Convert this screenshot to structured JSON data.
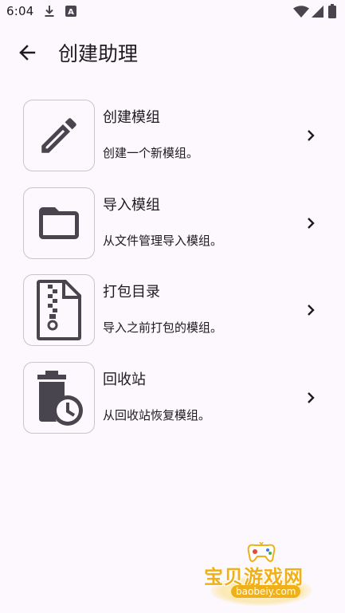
{
  "status_bar": {
    "time": "6:04",
    "icons": [
      "download-icon",
      "app-notification-a-icon",
      "wifi-icon",
      "signal-icon",
      "battery-icon"
    ],
    "notification_letter": "A"
  },
  "app_bar": {
    "back_icon": "arrow-left-icon",
    "title": "创建助理"
  },
  "menu_items": [
    {
      "icon": "pencil-icon",
      "title": "创建模组",
      "subtitle": "创建一个新模组。",
      "trailing_icon": "chevron-right-icon"
    },
    {
      "icon": "folder-icon",
      "title": "导入模组",
      "subtitle": "从文件管理导入模组。",
      "trailing_icon": "chevron-right-icon"
    },
    {
      "icon": "zip-file-icon",
      "title": "打包目录",
      "subtitle": "导入之前打包的模组。",
      "trailing_icon": "chevron-right-icon"
    },
    {
      "icon": "trash-clock-icon",
      "title": "回收站",
      "subtitle": "从回收站恢复模组。",
      "trailing_icon": "chevron-right-icon"
    }
  ],
  "watermark": {
    "brand": "宝贝游戏网",
    "url": "baobeiy.com"
  },
  "colors": {
    "background": "#fdf8fd",
    "text": "#1d1b20",
    "icon": "#49454f",
    "border": "#c9c4cc",
    "watermark": "#f0b01a"
  }
}
